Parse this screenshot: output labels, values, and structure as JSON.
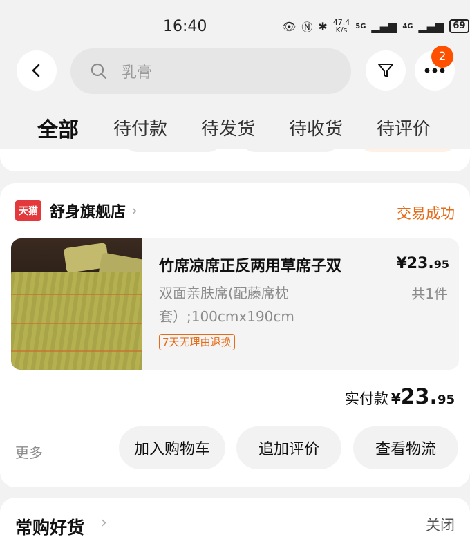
{
  "status_bar": {
    "time": "16:40",
    "net_speed": "47.4",
    "net_unit": "K/s",
    "net1": "5G",
    "net2": "4G",
    "battery": "69",
    "icons": [
      "eye-icon",
      "nfc-icon",
      "bluetooth-icon",
      "signal-icon",
      "battery-icon"
    ]
  },
  "header": {
    "search_placeholder": "乳膏",
    "badge_count": "2",
    "icons": [
      "back-icon",
      "search-icon",
      "filter-icon",
      "more-icon"
    ]
  },
  "tabs": [
    {
      "label": "全部",
      "active": true
    },
    {
      "label": "待付款"
    },
    {
      "label": "待发货"
    },
    {
      "label": "待收货"
    },
    {
      "label": "待评价"
    }
  ],
  "order": {
    "shop_badge": "天猫",
    "shop_name": "舒身旗舰店",
    "status": "交易成功",
    "item": {
      "title": "竹席凉席正反两用草席子双",
      "price_yen": "¥",
      "price_int": "23.",
      "price_dec": "95",
      "sku": "双面亲肤席(配藤席枕套）;100cmx190cm",
      "qty": "共1件",
      "tag": "7天无理由退换"
    },
    "paid_label": "实付款",
    "paid_yen": "¥",
    "paid_int": "23.",
    "paid_dec": "95",
    "more": "更多",
    "actions": [
      "加入购物车",
      "追加评价",
      "查看物流"
    ]
  },
  "recommend": {
    "title": "常购好货",
    "close": "关闭"
  },
  "colors": {
    "accent": "#ff5000",
    "status_orange": "#e46b17",
    "tmall_red": "#e4393c"
  }
}
